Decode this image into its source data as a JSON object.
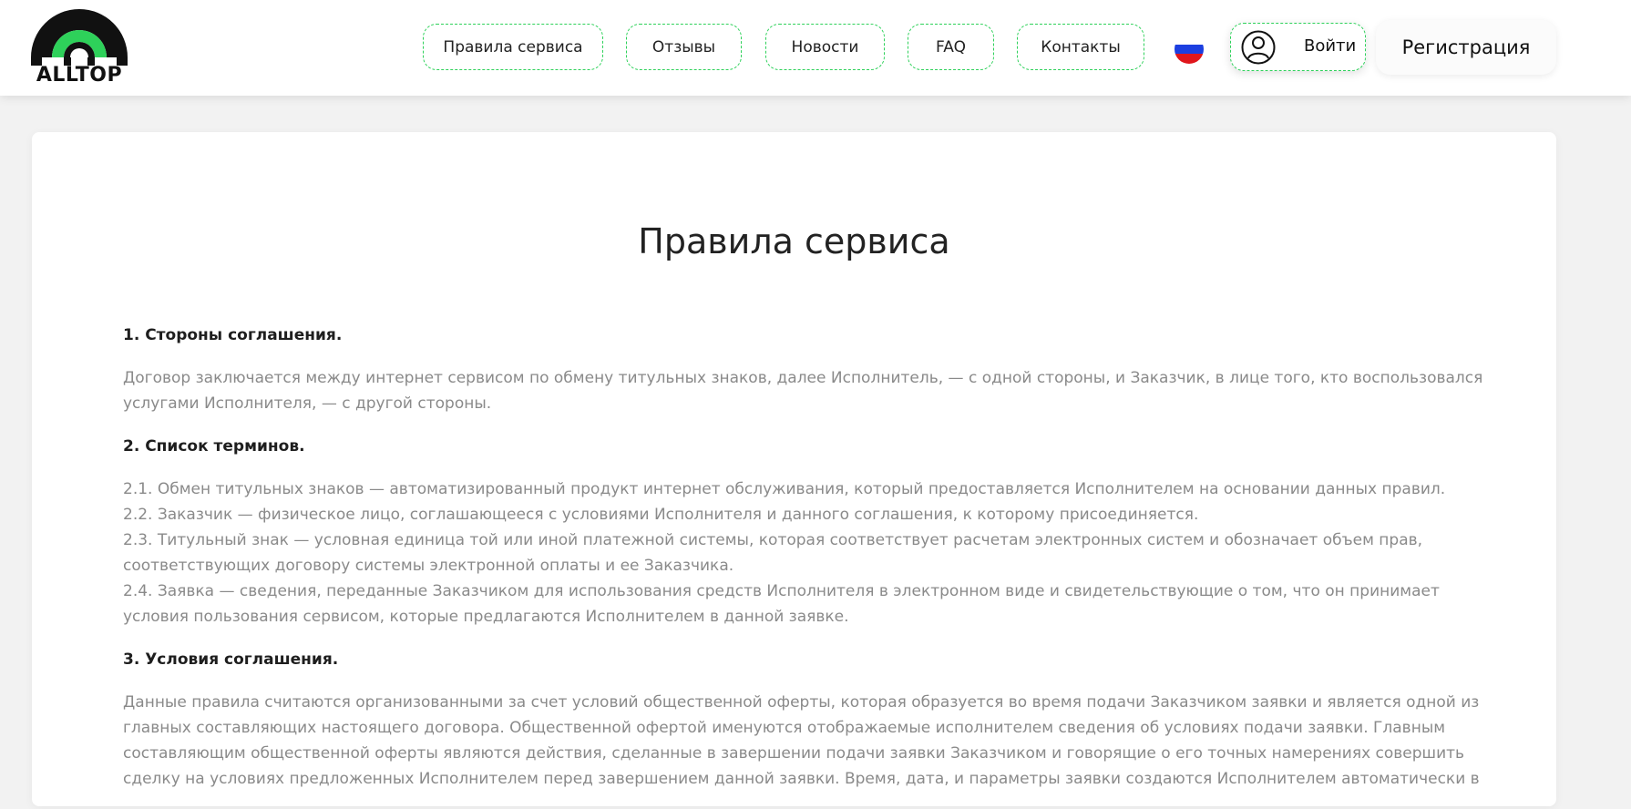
{
  "header": {
    "logo_text": "ALLTOP",
    "nav": [
      {
        "label": "Правила сервиса"
      },
      {
        "label": "Отзывы"
      },
      {
        "label": "Новости"
      },
      {
        "label": "FAQ"
      },
      {
        "label": "Контакты"
      }
    ],
    "language_flag": "ru-flag-icon",
    "login_label": "Войти",
    "register_label": "Регистрация",
    "accent_color": "#2ed15a"
  },
  "page": {
    "title": "Правила сервиса",
    "sections": [
      {
        "heading": "1. Стороны соглашения.",
        "paragraph": "Договор заключается между интернет сервисом по обмену титульных знаков, далее Исполнитель, — с одной стороны, и Заказчик, в лице того, кто воспользовался услугами Исполнителя, — с другой стороны."
      },
      {
        "heading": "2. Список терминов.",
        "terms": [
          "2.1. Обмен титульных знаков — автоматизированный продукт интернет обслуживания, который предоставляется Исполнителем на основании данных правил.",
          "2.2. Заказчик — физическое лицо, соглашающееся с условиями Исполнителя и данного соглашения, к которому присоединяется.",
          "2.3. Титульный знак — условная единица той или иной платежной системы, которая соответствует расчетам электронных систем и обозначает объем прав, соответствующих договору системы электронной оплаты и ее Заказчика.",
          "2.4. Заявка — сведения, переданные Заказчиком для использования средств Исполнителя в электронном виде и свидетельствующие о том, что он принимает условия пользования сервисом, которые предлагаются Исполнителем в данной заявке."
        ]
      },
      {
        "heading": "3. Условия соглашения.",
        "paragraph": "Данные правила считаются организованными за счет условий общественной оферты, которая образуется во время подачи Заказчиком заявки и является одной из главных составляющих настоящего договора. Общественной офертой именуются отображаемые исполнителем сведения об условиях подачи заявки. Главным составляющим общественной оферты являются действия, сделанные в завершении подачи заявки Заказчиком и говорящие о его точных намерениях совершить сделку на условиях предложенных Исполнителем перед завершением данной заявки. Время, дата, и параметры заявки создаются Исполнителем автоматически в"
      }
    ]
  }
}
